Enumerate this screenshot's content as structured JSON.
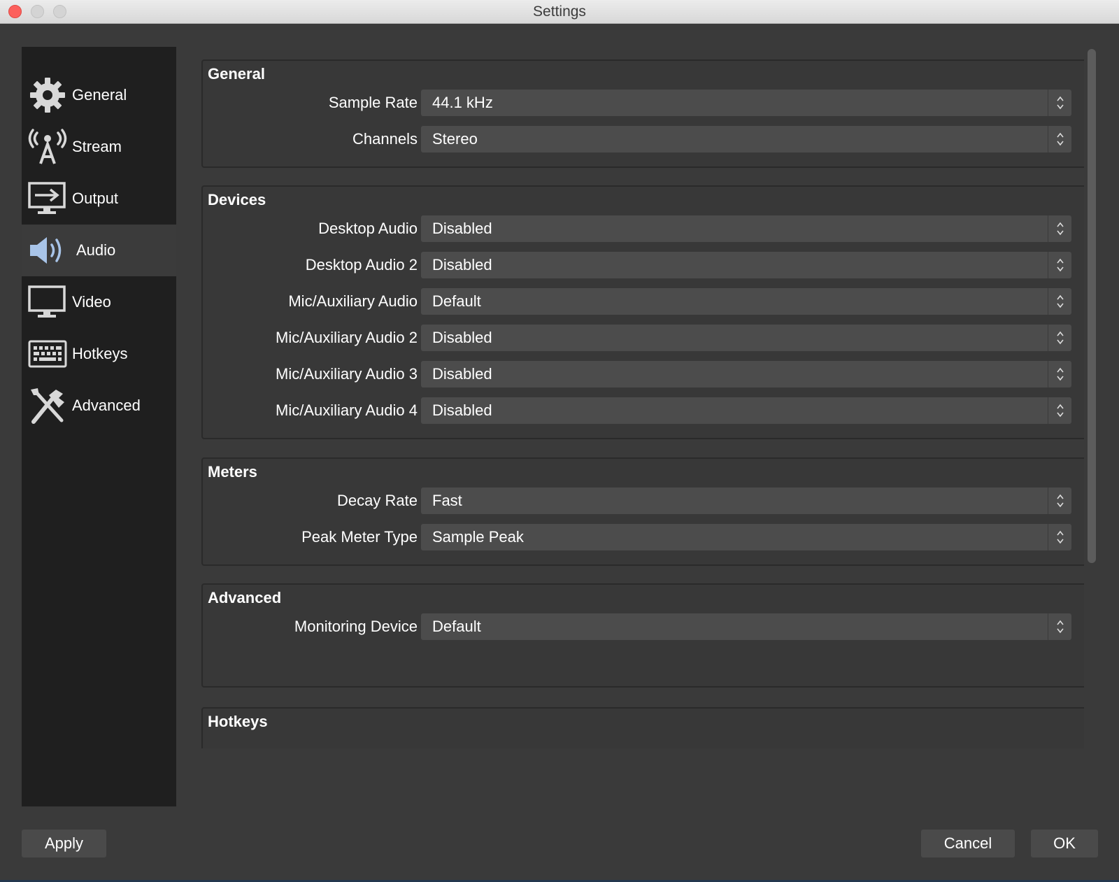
{
  "window": {
    "title": "Settings"
  },
  "sidebar": {
    "items": [
      {
        "label": "General",
        "icon": "gear-icon"
      },
      {
        "label": "Stream",
        "icon": "antenna-icon"
      },
      {
        "label": "Output",
        "icon": "output-monitor-icon"
      },
      {
        "label": "Audio",
        "icon": "speaker-icon",
        "active": true
      },
      {
        "label": "Video",
        "icon": "monitor-icon"
      },
      {
        "label": "Hotkeys",
        "icon": "keyboard-icon"
      },
      {
        "label": "Advanced",
        "icon": "tools-icon"
      }
    ]
  },
  "general": {
    "title": "General",
    "sample_rate": {
      "label": "Sample Rate",
      "value": "44.1 kHz"
    },
    "channels": {
      "label": "Channels",
      "value": "Stereo"
    }
  },
  "devices": {
    "title": "Devices",
    "desktop_audio": {
      "label": "Desktop Audio",
      "value": "Disabled"
    },
    "desktop_audio_2": {
      "label": "Desktop Audio 2",
      "value": "Disabled"
    },
    "mic_aux_audio": {
      "label": "Mic/Auxiliary Audio",
      "value": "Default"
    },
    "mic_aux_audio_2": {
      "label": "Mic/Auxiliary Audio 2",
      "value": "Disabled"
    },
    "mic_aux_audio_3": {
      "label": "Mic/Auxiliary Audio 3",
      "value": "Disabled"
    },
    "mic_aux_audio_4": {
      "label": "Mic/Auxiliary Audio 4",
      "value": "Disabled"
    }
  },
  "meters": {
    "title": "Meters",
    "decay_rate": {
      "label": "Decay Rate",
      "value": "Fast"
    },
    "peak_meter_type": {
      "label": "Peak Meter Type",
      "value": "Sample Peak"
    }
  },
  "advanced": {
    "title": "Advanced",
    "monitoring_device": {
      "label": "Monitoring Device",
      "value": "Default"
    }
  },
  "hotkeys": {
    "title": "Hotkeys"
  },
  "buttons": {
    "apply": "Apply",
    "cancel": "Cancel",
    "ok": "OK"
  },
  "colors": {
    "accent_icon": "#a8c4e8",
    "window_bg": "#3a3a3a",
    "sidebar_bg": "#1f1f1f",
    "close_button": "#fc605c"
  }
}
